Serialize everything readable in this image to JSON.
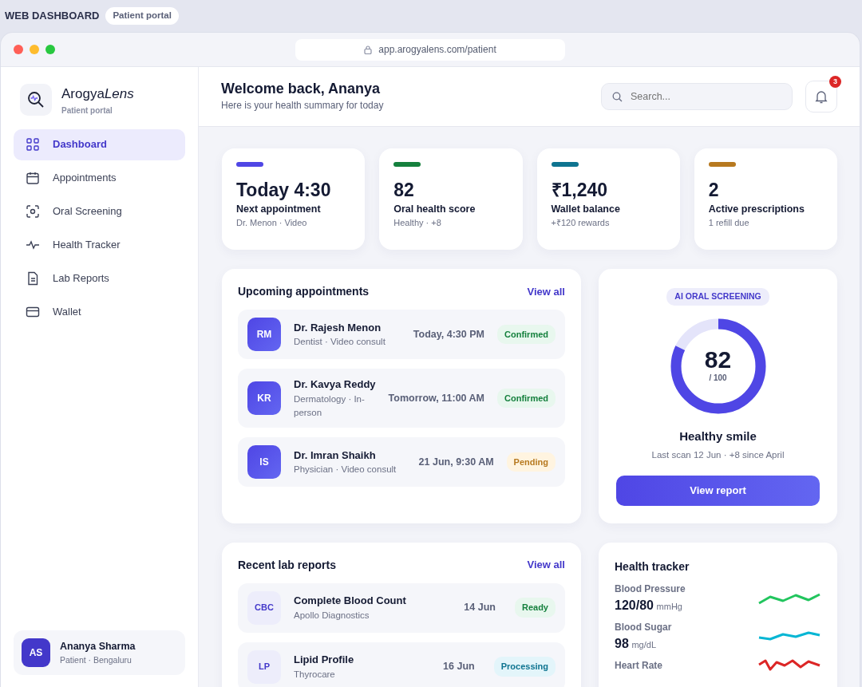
{
  "app_header": {
    "title": "WEB DASHBOARD",
    "tag": "Patient portal"
  },
  "browser": {
    "url": "app.arogyalens.com/patient"
  },
  "sidebar": {
    "brand": "Arogya",
    "brand_accent": "Lens",
    "brand_sub": "Patient portal",
    "items": [
      {
        "label": "Dashboard",
        "selected": true
      },
      {
        "label": "Appointments",
        "selected": false
      },
      {
        "label": "Oral Screening",
        "selected": false
      },
      {
        "label": "Health Tracker",
        "selected": false
      },
      {
        "label": "Lab Reports",
        "selected": false
      },
      {
        "label": "Wallet",
        "selected": false
      }
    ],
    "user": {
      "initials": "AS",
      "name": "Ananya Sharma",
      "sub": "Patient · Bengaluru"
    }
  },
  "header": {
    "title": "Welcome back, Ananya",
    "subtitle": "Here is your health summary for today",
    "search": {
      "placeholder": "Search..."
    },
    "notifications": "3"
  },
  "stats": [
    {
      "value": "Today 4:30",
      "label": "Next appointment",
      "sub": "Dr. Menon · Video",
      "color": "#4f46e5"
    },
    {
      "value": "82",
      "label": "Oral health score",
      "sub": "Healthy · +8",
      "color": "#15803d"
    },
    {
      "value": "₹1,240",
      "label": "Wallet balance",
      "sub": "+₹120 rewards",
      "color": "#0e7490"
    },
    {
      "value": "2",
      "label": "Active prescriptions",
      "sub": "1 refill due",
      "color": "#b7791f"
    }
  ],
  "appointments": {
    "title": "Upcoming appointments",
    "link": "View all",
    "rows": [
      {
        "initials": "RM",
        "name": "Dr. Rajesh Menon",
        "sub": "Dentist · Video consult",
        "time": "Today, 4:30 PM",
        "status": "Confirmed",
        "kind": "success"
      },
      {
        "initials": "KR",
        "name": "Dr. Kavya Reddy",
        "sub": "Dermatology · In-person",
        "time": "Tomorrow, 11:00 AM",
        "status": "Confirmed",
        "kind": "success"
      },
      {
        "initials": "IS",
        "name": "Dr. Imran Shaikh",
        "sub": "Physician · Video consult",
        "time": "21 Jun, 9:30 AM",
        "status": "Pending",
        "kind": "warning"
      }
    ]
  },
  "screening": {
    "tag": "AI ORAL SCREENING",
    "score": "82",
    "out_of": "/ 100",
    "level": 0.82,
    "title": "Healthy smile",
    "sub": "Last scan 12 Jun · +8 since April",
    "button": "View report"
  },
  "lab_reports": {
    "title": "Recent lab reports",
    "link": "View all",
    "rows": [
      {
        "code": "CBC",
        "name": "Complete Blood Count",
        "sub": "Apollo Diagnostics",
        "date": "14 Jun",
        "status": "Ready",
        "kind": "success"
      },
      {
        "code": "LP",
        "name": "Lipid Profile",
        "sub": "Thyrocare",
        "date": "16 Jun",
        "status": "Processing",
        "kind": "info"
      }
    ]
  },
  "health_tracker": {
    "title": "Health tracker",
    "rows": [
      {
        "label": "Blood Pressure",
        "value": "120/80",
        "unit": "mmHg",
        "color": "#22c55e"
      },
      {
        "label": "Blood Sugar",
        "value": "98",
        "unit": "mg/dL",
        "color": "#06b6d4"
      },
      {
        "label": "Heart Rate",
        "color": "#dc2626"
      }
    ]
  }
}
